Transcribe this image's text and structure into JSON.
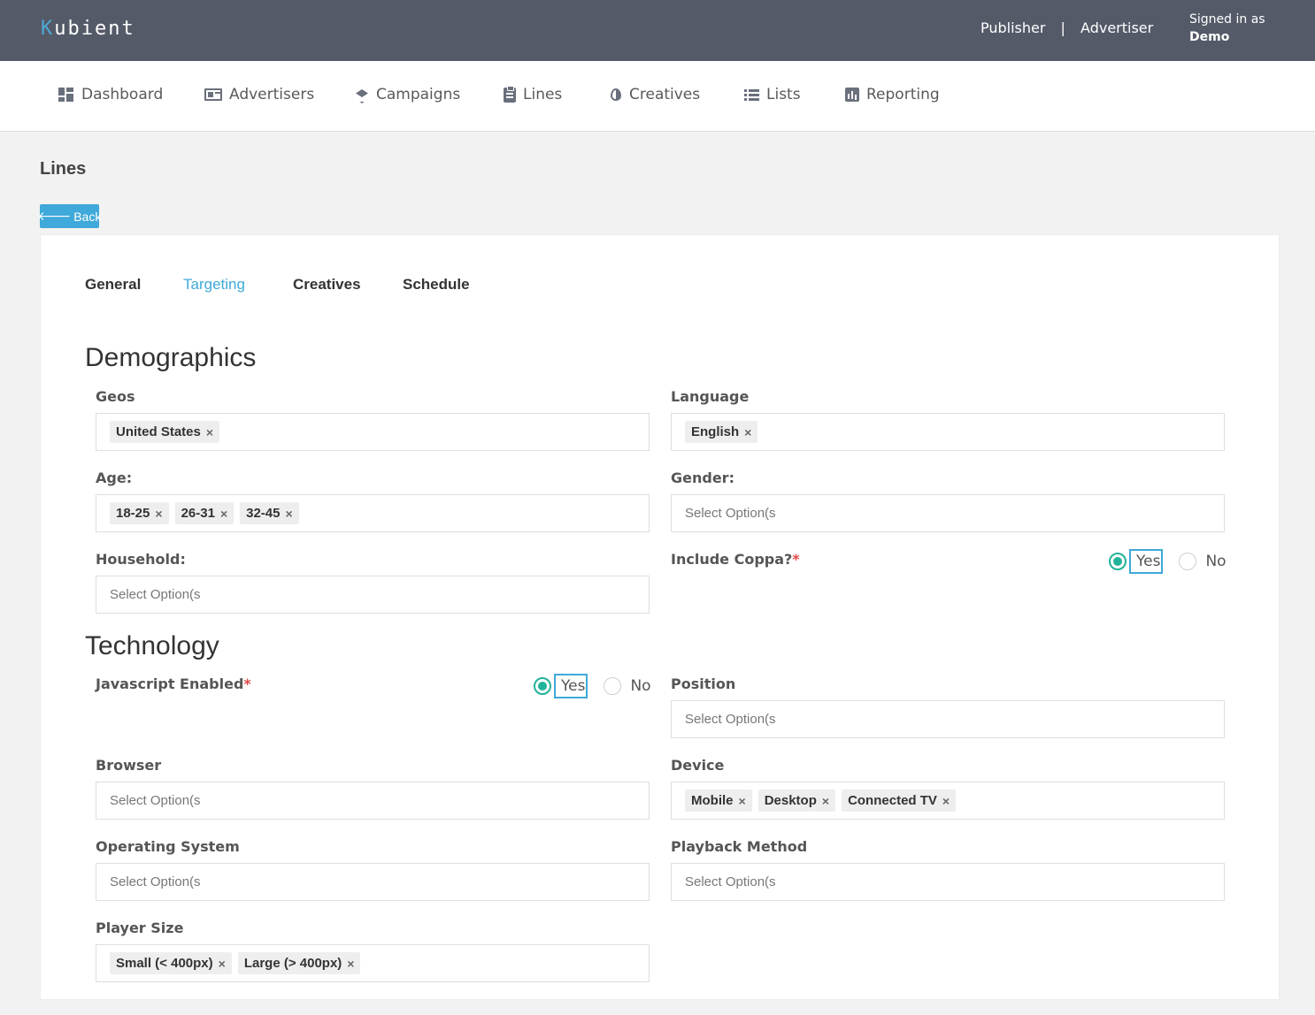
{
  "brand": {
    "first": "K",
    "rest": "ubient"
  },
  "top_links": [
    "Publisher",
    "Advertiser"
  ],
  "top_sep": "|",
  "signed": {
    "label": "Signed in as",
    "user": "Demo"
  },
  "nav": [
    "Dashboard",
    "Advertisers",
    "Campaigns",
    "Lines",
    "Creatives",
    "Lists",
    "Reporting"
  ],
  "page_title": "Lines",
  "back_label": "Back",
  "tabs": [
    "General",
    "Targeting",
    "Creatives",
    "Schedule"
  ],
  "active_tab": "Targeting",
  "sections": {
    "demographics": "Demographics",
    "technology": "Technology"
  },
  "placeholder": "Select Option(s",
  "fields": {
    "geos": {
      "label": "Geos",
      "chips": [
        "United States"
      ]
    },
    "language": {
      "label": "Language",
      "chips": [
        "English"
      ]
    },
    "age": {
      "label": "Age:",
      "chips": [
        "18-25",
        "26-31",
        "32-45"
      ]
    },
    "gender": {
      "label": "Gender:"
    },
    "household": {
      "label": "Household:"
    },
    "coppa": {
      "label": "Include Coppa?",
      "required": "*",
      "yes": "Yes",
      "no": "No",
      "selected": "Yes"
    },
    "javascript": {
      "label": "Javascript Enabled",
      "required": "*",
      "yes": "Yes",
      "no": "No",
      "selected": "Yes"
    },
    "position": {
      "label": "Position"
    },
    "browser": {
      "label": "Browser"
    },
    "device": {
      "label": "Device",
      "chips": [
        "Mobile",
        "Desktop",
        "Connected TV"
      ]
    },
    "os": {
      "label": "Operating System"
    },
    "playback": {
      "label": "Playback Method"
    },
    "player_size": {
      "label": "Player Size",
      "chips": [
        "Small (< 400px)",
        "Large (> 400px)"
      ]
    }
  },
  "chip_remove": "×",
  "colors": {
    "topbar": "#545a68",
    "accent": "#3fa9d9",
    "radio": "#21b39a",
    "required": "#e04848"
  }
}
